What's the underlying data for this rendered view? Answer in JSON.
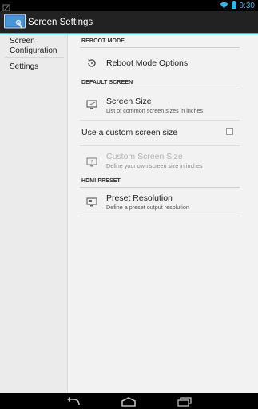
{
  "status_bar": {
    "time": "9:30",
    "colors": {
      "accent": "#33b5e5"
    }
  },
  "action_bar": {
    "title": "Screen Settings"
  },
  "sidebar": {
    "items": [
      {
        "label": "Screen Configuration"
      },
      {
        "label": "Settings"
      }
    ]
  },
  "content": {
    "categories": [
      {
        "title": "REBOOT MODE"
      },
      {
        "title": "DEFAULT SCREEN"
      },
      {
        "title": "HDMI PRESET"
      }
    ],
    "reboot_mode": {
      "title": "Reboot Mode Options",
      "icon": "reboot-icon"
    },
    "screen_size": {
      "title": "Screen Size",
      "subtitle": "List of common screen sizes in inches",
      "icon": "screen-icon"
    },
    "custom_toggle": {
      "label": "Use a custom screen size",
      "checked": false
    },
    "custom_size": {
      "title": "Custom Screen Size",
      "subtitle": "Define your own screen size in inches",
      "icon": "custom-screen-icon",
      "enabled": false
    },
    "preset_resolution": {
      "title": "Preset Resolution",
      "subtitle": "Define a preset output resolution",
      "icon": "resolution-icon"
    }
  }
}
